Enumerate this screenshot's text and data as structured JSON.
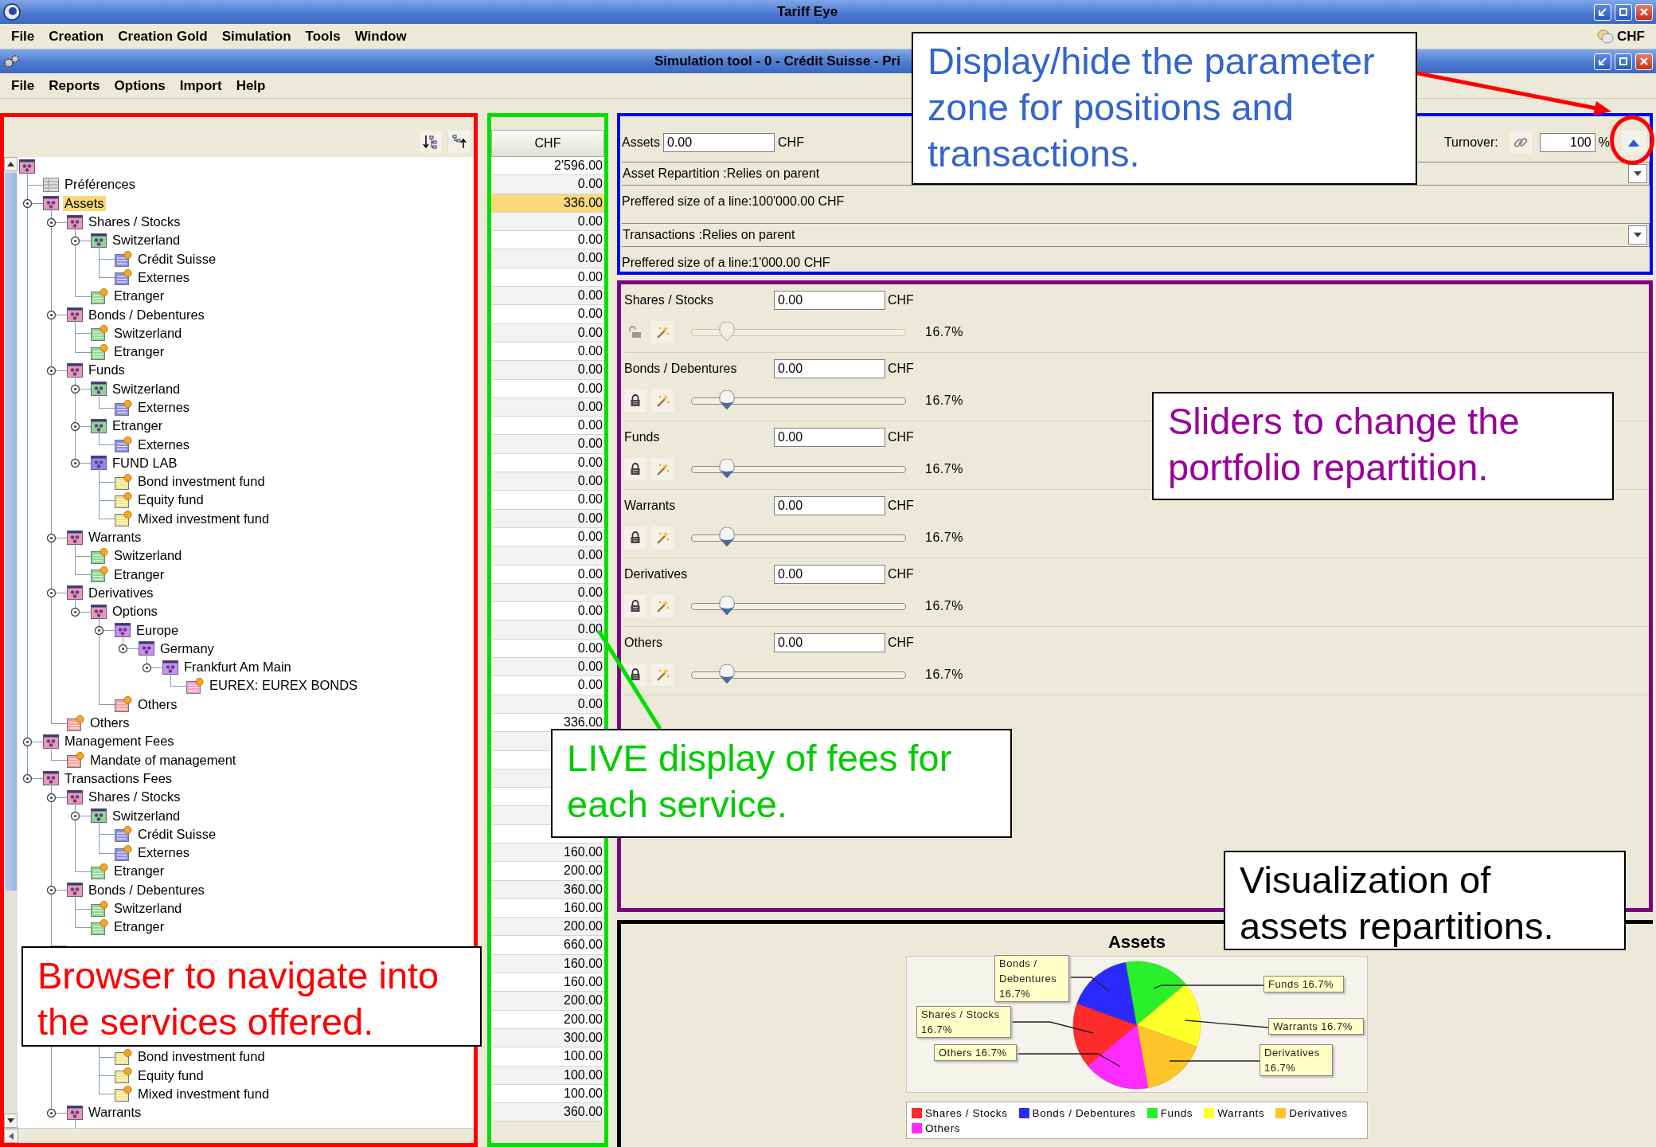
{
  "window": {
    "title": "Tariff Eye"
  },
  "menu": [
    "File",
    "Creation",
    "Creation Gold",
    "Simulation",
    "Tools",
    "Window"
  ],
  "currency": "CHF",
  "tool_window": {
    "title": "Simulation tool - 0 - Crédit Suisse - Pri"
  },
  "tool_menu": [
    "File",
    "Reports",
    "Options",
    "Import",
    "Help"
  ],
  "tree": {
    "kind": "group",
    "color": "#e89ab4",
    "children": [
      {
        "label": "Préférences",
        "kind": "table",
        "color": "#dcdcdc",
        "selected": false
      },
      {
        "label": "Assets",
        "kind": "group",
        "color": "#e89ab4",
        "selected": true,
        "children": [
          {
            "label": "Shares / Stocks",
            "kind": "group",
            "color": "#e89ab4",
            "selected": false,
            "children": [
              {
                "label": "Switzerland",
                "kind": "group",
                "color": "#8cd890",
                "selected": false,
                "children": [
                  {
                    "label": "Crédit Suisse",
                    "kind": "leaf",
                    "color": "#8c8ce8",
                    "selected": false
                  },
                  {
                    "label": "Externes",
                    "kind": "leaf",
                    "color": "#8c8ce8",
                    "selected": false
                  }
                ]
              },
              {
                "label": "Etranger",
                "kind": "leaf",
                "color": "#8cd890",
                "selected": false
              }
            ]
          },
          {
            "label": "Bonds / Debentures",
            "kind": "group",
            "color": "#e89ab4",
            "selected": false,
            "children": [
              {
                "label": "Switzerland",
                "kind": "leaf",
                "color": "#8cd890",
                "selected": false
              },
              {
                "label": "Etranger",
                "kind": "leaf",
                "color": "#8cd890",
                "selected": false
              }
            ]
          },
          {
            "label": "Funds",
            "kind": "group",
            "color": "#e89ab4",
            "selected": false,
            "children": [
              {
                "label": "Switzerland",
                "kind": "group",
                "color": "#8cd890",
                "selected": false,
                "children": [
                  {
                    "label": "Externes",
                    "kind": "leaf",
                    "color": "#8c8ce8",
                    "selected": false
                  }
                ]
              },
              {
                "label": "Etranger",
                "kind": "group",
                "color": "#8cd890",
                "selected": false,
                "children": [
                  {
                    "label": "Externes",
                    "kind": "leaf",
                    "color": "#8c8ce8",
                    "selected": false
                  }
                ]
              },
              {
                "label": "FUND LAB",
                "kind": "group",
                "color": "#8c8ce8",
                "selected": false,
                "children": [
                  {
                    "label": "Bond investment fund",
                    "kind": "leaf",
                    "color": "#f2e48c",
                    "selected": false
                  },
                  {
                    "label": "Equity fund",
                    "kind": "leaf",
                    "color": "#f2e48c",
                    "selected": false
                  },
                  {
                    "label": "Mixed investment fund",
                    "kind": "leaf",
                    "color": "#f2e48c",
                    "selected": false
                  }
                ]
              }
            ]
          },
          {
            "label": "Warrants",
            "kind": "group",
            "color": "#e89ab4",
            "selected": false,
            "children": [
              {
                "label": "Switzerland",
                "kind": "leaf",
                "color": "#8cd890",
                "selected": false
              },
              {
                "label": "Etranger",
                "kind": "leaf",
                "color": "#8cd890",
                "selected": false
              }
            ]
          },
          {
            "label": "Derivatives",
            "kind": "group",
            "color": "#e89ab4",
            "selected": false,
            "children": [
              {
                "label": "Options",
                "kind": "group",
                "color": "#e89ab4",
                "selected": false,
                "children": [
                  {
                    "label": "Europe",
                    "kind": "group",
                    "color": "#c890f0",
                    "selected": false,
                    "children": [
                      {
                        "label": "Germany",
                        "kind": "group",
                        "color": "#c890f0",
                        "selected": false,
                        "children": [
                          {
                            "label": "Frankfurt Am Main",
                            "kind": "group",
                            "color": "#c890f0",
                            "selected": false,
                            "children": [
                              {
                                "label": "EUREX: EUREX BONDS",
                                "kind": "leaf",
                                "color": "#f0a0d0",
                                "selected": false
                              }
                            ]
                          }
                        ]
                      }
                    ]
                  },
                  {
                    "label": "Others",
                    "kind": "leaf",
                    "color": "#f4a0a0",
                    "selected": false
                  }
                ]
              }
            ]
          },
          {
            "label": "Others",
            "kind": "leaf",
            "color": "#f4a0a0",
            "selected": false
          }
        ]
      },
      {
        "label": "Management Fees",
        "kind": "group",
        "color": "#e89ab4",
        "selected": false,
        "children": [
          {
            "label": "Mandate of management",
            "kind": "leaf",
            "color": "#f4a0a0",
            "selected": false
          }
        ]
      },
      {
        "label": "Transactions Fees",
        "kind": "group",
        "color": "#e89ab4",
        "selected": false,
        "children": [
          {
            "label": "Shares / Stocks",
            "kind": "group",
            "color": "#e89ab4",
            "selected": false,
            "children": [
              {
                "label": "Switzerland",
                "kind": "group",
                "color": "#8cd890",
                "selected": false,
                "children": [
                  {
                    "label": "Crédit Suisse",
                    "kind": "leaf",
                    "color": "#8c8ce8",
                    "selected": false
                  },
                  {
                    "label": "Externes",
                    "kind": "leaf",
                    "color": "#8c8ce8",
                    "selected": false
                  }
                ]
              },
              {
                "label": "Etranger",
                "kind": "leaf",
                "color": "#8cd890",
                "selected": false
              }
            ]
          },
          {
            "label": "Bonds / Debentures",
            "kind": "group",
            "color": "#e89ab4",
            "selected": false,
            "children": [
              {
                "label": "Switzerland",
                "kind": "leaf",
                "color": "#8cd890",
                "selected": false
              },
              {
                "label": "Etranger",
                "kind": "leaf",
                "color": "#8cd890",
                "selected": false
              }
            ]
          },
          {
            "kind": "covered",
            "children": [
              {
                "kind": "covered",
                "children": [
                  {
                    "kind": "covered"
                  }
                ]
              },
              {
                "kind": "covered",
                "children": [
                  {
                    "kind": "covered"
                  }
                ]
              },
              {
                "kind": "covered",
                "children": [
                  {
                    "label": "Bond investment fund",
                    "kind": "leaf",
                    "color": "#f2e48c",
                    "selected": false
                  },
                  {
                    "label": "Equity fund",
                    "kind": "leaf",
                    "color": "#f2e48c",
                    "selected": false
                  },
                  {
                    "label": "Mixed investment fund",
                    "kind": "leaf",
                    "color": "#f2e48c",
                    "selected": false
                  }
                ]
              }
            ]
          },
          {
            "label": "Warrants",
            "kind": "group",
            "color": "#e89ab4",
            "selected": false,
            "children": [
              {
                "kind": "covered"
              }
            ]
          }
        ]
      }
    ]
  },
  "fees": {
    "header": "CHF",
    "cells": [
      {
        "value": "2'596.00",
        "selected": false
      },
      {
        "value": "0.00",
        "selected": false
      },
      {
        "value": "336.00",
        "selected": true
      },
      {
        "value": "0.00",
        "selected": false
      },
      {
        "value": "0.00",
        "selected": false
      },
      {
        "value": "0.00",
        "selected": false
      },
      {
        "value": "0.00",
        "selected": false
      },
      {
        "value": "0.00",
        "selected": false
      },
      {
        "value": "0.00",
        "selected": false
      },
      {
        "value": "0.00",
        "selected": false
      },
      {
        "value": "0.00",
        "selected": false
      },
      {
        "value": "0.00",
        "selected": false
      },
      {
        "value": "0.00",
        "selected": false
      },
      {
        "value": "0.00",
        "selected": false
      },
      {
        "value": "0.00",
        "selected": false
      },
      {
        "value": "0.00",
        "selected": false
      },
      {
        "value": "0.00",
        "selected": false
      },
      {
        "value": "0.00",
        "selected": false
      },
      {
        "value": "0.00",
        "selected": false
      },
      {
        "value": "0.00",
        "selected": false
      },
      {
        "value": "0.00",
        "selected": false
      },
      {
        "value": "0.00",
        "selected": false
      },
      {
        "value": "0.00",
        "selected": false
      },
      {
        "value": "0.00",
        "selected": false
      },
      {
        "value": "0.00",
        "selected": false
      },
      {
        "value": "0.00",
        "selected": false
      },
      {
        "value": "0.00",
        "selected": false
      },
      {
        "value": "0.00",
        "selected": false
      },
      {
        "value": "0.00",
        "selected": false
      },
      {
        "value": "0.00",
        "selected": false
      },
      {
        "value": "336.00",
        "selected": false
      },
      {},
      {},
      {},
      {},
      {},
      {},
      {
        "value": "160.00",
        "selected": false
      },
      {
        "value": "200.00",
        "selected": false
      },
      {
        "value": "360.00",
        "selected": false
      },
      {
        "value": "160.00",
        "selected": false
      },
      {
        "value": "200.00",
        "selected": false
      },
      {
        "value": "660.00",
        "selected": false
      },
      {
        "value": "160.00",
        "selected": false
      },
      {
        "value": "160.00",
        "selected": false
      },
      {
        "value": "200.00",
        "selected": false
      },
      {
        "value": "200.00",
        "selected": false
      },
      {
        "value": "300.00",
        "selected": false
      },
      {
        "value": "100.00",
        "selected": false
      },
      {
        "value": "100.00",
        "selected": false
      },
      {
        "value": "100.00",
        "selected": false
      },
      {
        "value": "360.00",
        "selected": false
      }
    ]
  },
  "parameters": {
    "assets_label": "Assets",
    "assets_value": "0.00",
    "assets_unit": "CHF",
    "turnover_label": "Turnover:",
    "turnover_value": "100",
    "turnover_unit": "%",
    "dropdowns": [
      {
        "value": "Asset Repartition :Relies on parent",
        "note": "Preffered size of a line:100'000.00 CHF"
      },
      {
        "value": "Transactions :Relies on parent",
        "note": "Preffered size of a line:1'000.00 CHF"
      }
    ]
  },
  "allocations": [
    {
      "name": "Shares / Stocks",
      "value": "0.00",
      "unit": "CHF",
      "locked": false,
      "level": 0.167,
      "percent": "16.7%"
    },
    {
      "name": "Bonds / Debentures",
      "value": "0.00",
      "unit": "CHF",
      "locked": true,
      "level": 0.167,
      "percent": "16.7%"
    },
    {
      "name": "Funds",
      "value": "0.00",
      "unit": "CHF",
      "locked": true,
      "level": 0.167,
      "percent": "16.7%"
    },
    {
      "name": "Warrants",
      "value": "0.00",
      "unit": "CHF",
      "locked": true,
      "level": 0.167,
      "percent": "16.7%"
    },
    {
      "name": "Derivatives",
      "value": "0.00",
      "unit": "CHF",
      "locked": true,
      "level": 0.167,
      "percent": "16.7%"
    },
    {
      "name": "Others",
      "value": "0.00",
      "unit": "CHF",
      "locked": true,
      "level": 0.167,
      "percent": "16.7%"
    }
  ],
  "chart": {
    "chart_data": {
      "type": "pie",
      "title": "Assets",
      "categories": [
        "Shares / Stocks",
        "Bonds / Debentures",
        "Funds",
        "Warrants",
        "Derivatives",
        "Others"
      ],
      "series": [
        {
          "values": [
            16.7,
            16.7,
            16.7,
            16.7,
            16.7,
            16.7
          ]
        }
      ],
      "value_labels": [
        "Shares / Stocks 16.7%",
        "Bonds / Debentures 16.7%",
        "Funds 16.7%",
        "Warrants 16.7%",
        "Derivatives 16.7%",
        "Others 16.7%"
      ]
    },
    "legend": [
      {
        "color": "#ff2a2a"
      },
      {
        "color": "#2a2aff"
      },
      {
        "color": "#2af02a"
      },
      {
        "color": "#ffff2a"
      },
      {
        "color": "#ffc42a"
      },
      {
        "color": "#ff2aff"
      }
    ]
  },
  "annotations": [
    {
      "text": "Display/hide the parameter zone for positions and transactions.",
      "color": "#3366cc"
    },
    {
      "text": "Sliders to change the portfolio repartition.",
      "color": "#990099"
    },
    {
      "text": "LIVE display of fees for each service.",
      "color": "#00cc00"
    },
    {
      "text": "Browser to navigate into the services offered.",
      "color": "#ff0000"
    },
    {
      "text": "Visualization of assets repartitions.",
      "color": "#000000"
    }
  ]
}
